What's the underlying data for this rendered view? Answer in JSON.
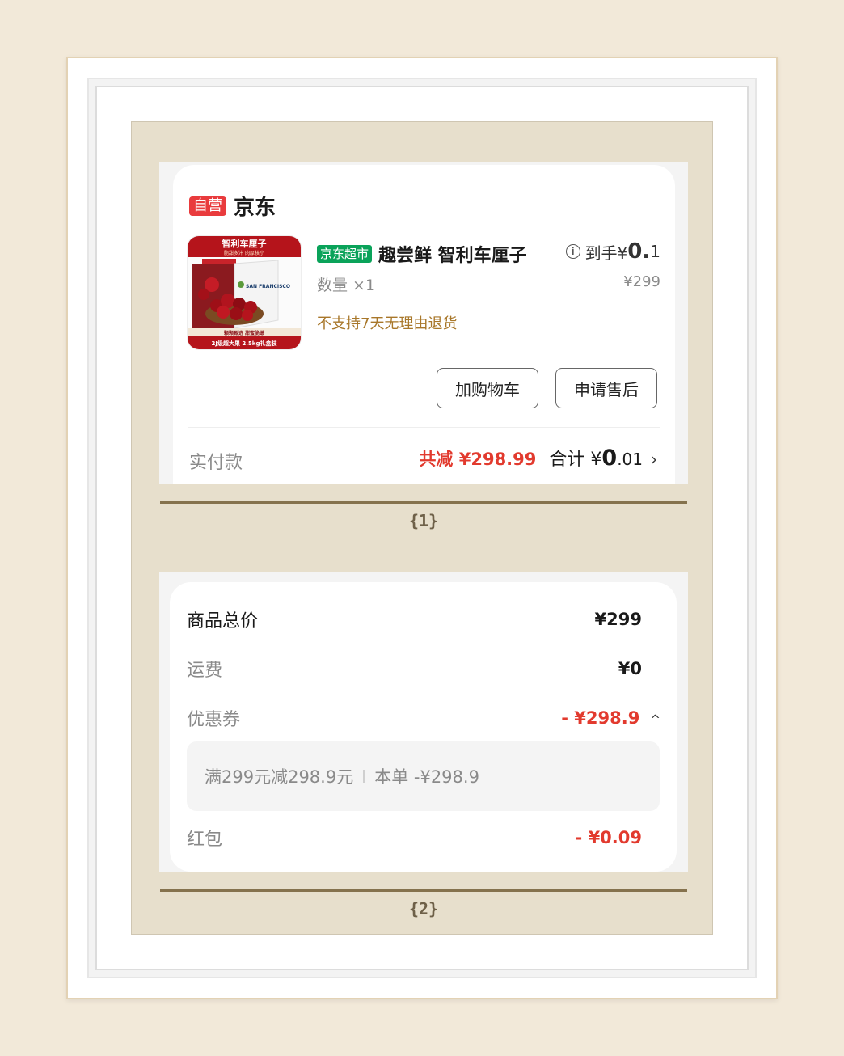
{
  "section1": {
    "shop_badge": "自营",
    "shop_name": "京东",
    "product": {
      "mart_badge": "京东超市",
      "title": "趣尝鲜 智利车厘子",
      "info_icon": "info-icon",
      "received_label": "到手¥",
      "received_big": "0.",
      "received_small": "1",
      "original_price": "¥299",
      "quantity": "数量 ×1",
      "no_return": "不支持7天无理由退货",
      "image": {
        "top_title": "智利车厘子",
        "top_sub": "脆甜多汁 肉厚核小",
        "brand": "SAN FRANCISCO",
        "bottom_line1": "颗颗甄选 甜蜜脆嫩",
        "bottom_line2": "2J级超大果 2.5kg礼盒装"
      }
    },
    "buttons": {
      "add_cart": "加购物车",
      "after_sale": "申请售后"
    },
    "paid_label": "实付款",
    "reduced": "共减 ¥298.99",
    "total_label": "合计 ¥",
    "total_big": "0",
    "total_small": ".01",
    "chevron": "›"
  },
  "caption1": "{1}",
  "section2": {
    "rows": [
      {
        "label": "商品总价",
        "value": "¥299"
      },
      {
        "label": "运费",
        "value": "¥0"
      },
      {
        "label": "优惠券",
        "value": "- ¥298.9"
      }
    ],
    "coupon_chevron": "^",
    "coupon_detail": {
      "rule": "满299元减298.9元",
      "this_order": "本单 -¥298.9"
    },
    "red_packet": {
      "label": "红包",
      "value": "- ¥0.09"
    }
  },
  "caption2": "{2}",
  "colors": {
    "red": "#e23a2e",
    "green_badge": "#0aa35a",
    "brown_text": "#a8772a",
    "mat": "#e7dfcc"
  }
}
